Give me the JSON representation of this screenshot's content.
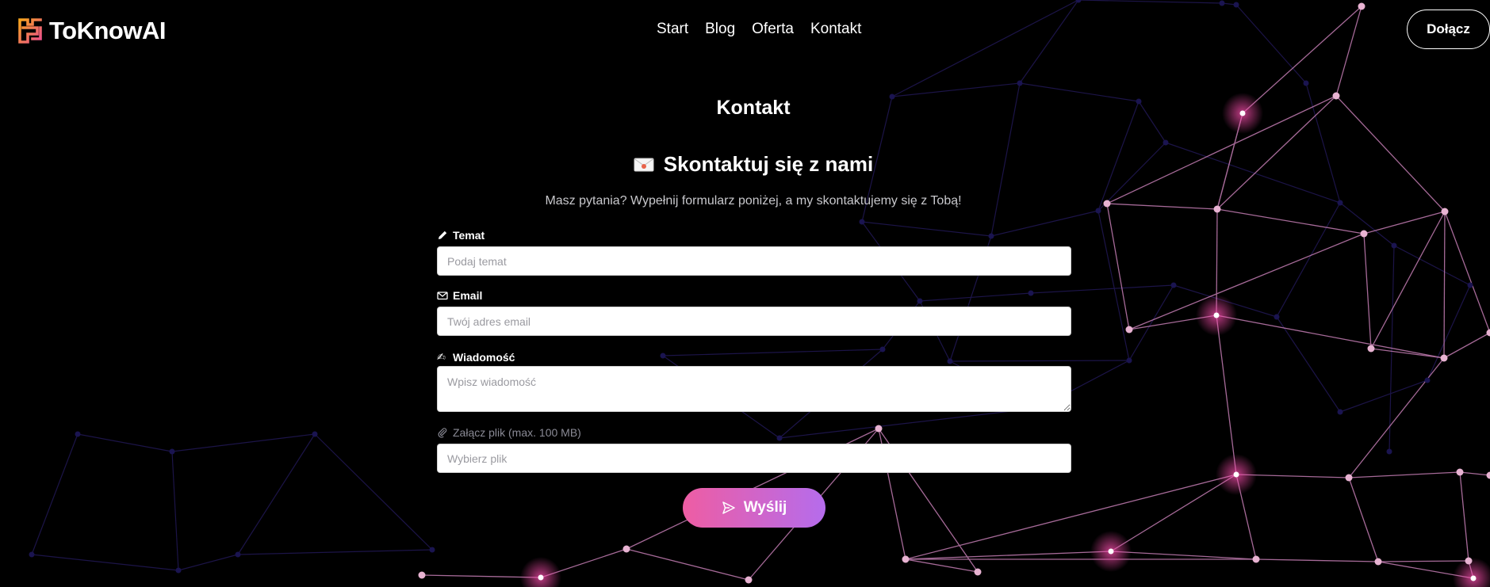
{
  "brand": {
    "name": "ToKnowAI",
    "logo_icon": "maze-logo-icon"
  },
  "nav": {
    "items": [
      {
        "label": "Start"
      },
      {
        "label": "Blog"
      },
      {
        "label": "Oferta"
      },
      {
        "label": "Kontakt"
      }
    ]
  },
  "header": {
    "join_label": "Dołącz"
  },
  "page": {
    "title": "Kontakt",
    "form_title": "Skontaktuj się z nami",
    "subtitle": "Masz pytania? Wypełnij formularz poniżej, a my skontaktujemy się z Tobą!"
  },
  "form": {
    "subject": {
      "label": "Temat",
      "placeholder": "Podaj temat",
      "icon": "pencil-icon"
    },
    "email": {
      "label": "Email",
      "placeholder": "Twój adres email",
      "icon": "mail-icon"
    },
    "message": {
      "label": "Wiadomość",
      "placeholder": "Wpisz wiadomość",
      "icon": "writing-hand-icon"
    },
    "attachment": {
      "label": "Załącz plik (max. 100 MB)",
      "placeholder": "Wybierz plik",
      "icon": "paperclip-icon"
    },
    "submit_label": "Wyślij"
  },
  "colors": {
    "accent_start": "#ee5da3",
    "accent_end": "#b56cec",
    "background": "#000000",
    "network_node": "#f0b8dc",
    "network_line": "#c878b4"
  }
}
